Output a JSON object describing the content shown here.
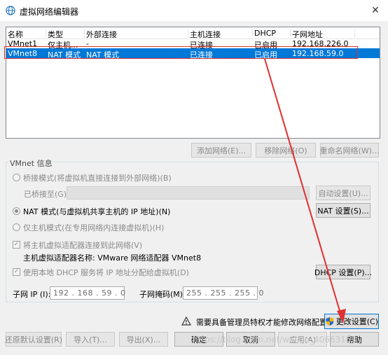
{
  "window": {
    "title": "虚拟网络编辑器"
  },
  "network_table": {
    "columns": [
      "名称",
      "类型",
      "外部连接",
      "主机连接",
      "DHCP",
      "子网地址"
    ],
    "rows": [
      [
        "VMnet1",
        "仅主机...",
        "-",
        "已连接",
        "已启用",
        "192.168.226.0"
      ],
      [
        "VMnet8",
        "NAT 模式",
        "NAT 模式",
        "已连接",
        "已启用",
        "192.168.59.0"
      ]
    ],
    "selected_row": 1
  },
  "network_buttons": {
    "add": "添加网络(E)...",
    "remove": "移除网络(O)",
    "rename": "重命名网络(W)..."
  },
  "vmnet_info": {
    "group_label": "VMnet 信息",
    "bridged_label": "桥接模式(将虚拟机直接连接到外部网络)(B)",
    "bridged_to_label": "已桥接至(G):",
    "auto_settings": "自动设置(U)...",
    "nat_label": "NAT 模式(与虚拟机共享主机的 IP 地址)(N)",
    "nat_settings": "NAT 设置(S)...",
    "hostonly_label": "仅主机模式(在专用网络内连接虚拟机)(H)",
    "connect_adapter_label": "将主机虚拟适配器连接到此网络(V)",
    "adapter_name": "主机虚拟适配器名称: VMware 网络适配器 VMnet8",
    "dhcp_label": "使用本地 DHCP 服务将 IP 地址分配给虚拟机(D)",
    "dhcp_settings": "DHCP 设置(P)...",
    "subnet_ip_label": "子网 IP (I):",
    "subnet_ip": "192 . 168 . 59 . 0",
    "subnet_mask_label": "子网掩码(M):",
    "subnet_mask": "255 . 255 . 255 . 0"
  },
  "admin_notice": {
    "text": "需要具备管理员特权才能修改网络配置。",
    "change_settings": "更改设置(C)"
  },
  "bottom_buttons": {
    "restore_defaults": "还原默认设置(R)",
    "import": "导入(T)...",
    "export": "导出(X)...",
    "ok": "确定",
    "cancel": "取消",
    "apply": "应用(A)",
    "help": "帮助"
  },
  "watermark": "https://blog.csdn.net/weixin_40663163",
  "colors": {
    "selection": "#0078d7",
    "annotation_red": "#e03030"
  }
}
